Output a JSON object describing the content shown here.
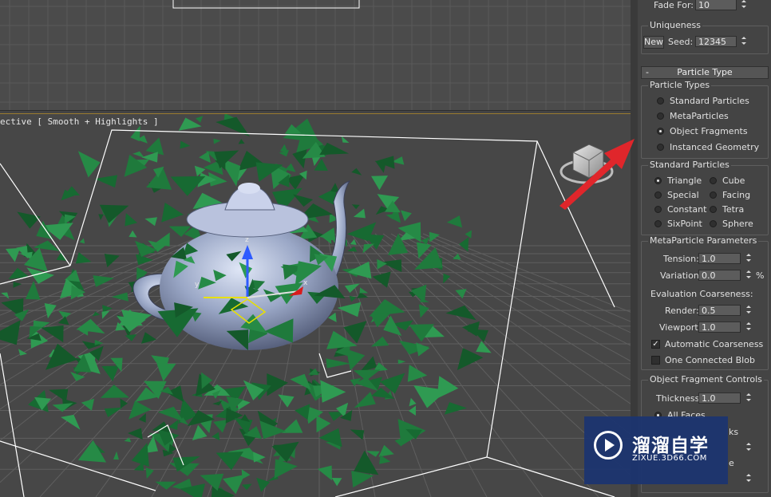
{
  "viewports": {
    "perspective_label": "ective [ Smooth + Highlights ]"
  },
  "panel": {
    "fade_for": {
      "label": "Fade For:",
      "value": "10"
    },
    "uniqueness": {
      "title": "Uniqueness",
      "new_label": "New",
      "seed_label": "Seed:",
      "seed_value": "12345"
    },
    "rollout_title": "Particle Type",
    "rollout_toggle": "-",
    "particle_types": {
      "title": "Particle Types",
      "options": [
        "Standard Particles",
        "MetaParticles",
        "Object Fragments",
        "Instanced Geometry"
      ],
      "selected": "Object Fragments"
    },
    "standard_particles": {
      "title": "Standard Particles",
      "options": [
        "Triangle",
        "Cube",
        "Special",
        "Facing",
        "Constant",
        "Tetra",
        "SixPoint",
        "Sphere"
      ],
      "selected": "Triangle"
    },
    "metaparticle": {
      "title": "MetaParticle Parameters",
      "tension_label": "Tension:",
      "tension_value": "1.0",
      "variation_label": "Variation:",
      "variation_value": "0.0",
      "variation_unit": "%",
      "eval_label": "Evaluation Coarseness:",
      "render_label": "Render:",
      "render_value": "0.5",
      "viewport_label": "Viewport:",
      "viewport_value": "1.0",
      "auto_label": "Automatic Coarseness",
      "auto_checked": true,
      "blob_label": "One Connected Blob",
      "blob_checked": false
    },
    "fragment": {
      "title": "Object Fragment Controls",
      "thickness_label": "Thickness:",
      "thickness_value": "1.0",
      "all_faces_label": "All Faces",
      "partial_1": "ks",
      "partial_2": "e"
    }
  },
  "watermark": {
    "cn": "溜溜自学",
    "url": "ZIXUE.3D66.COM"
  },
  "colors": {
    "accent": "#9a7b2e",
    "fragments": "#1f7a3c",
    "arrow": "#e0262b",
    "watermark": "#1b3470"
  }
}
